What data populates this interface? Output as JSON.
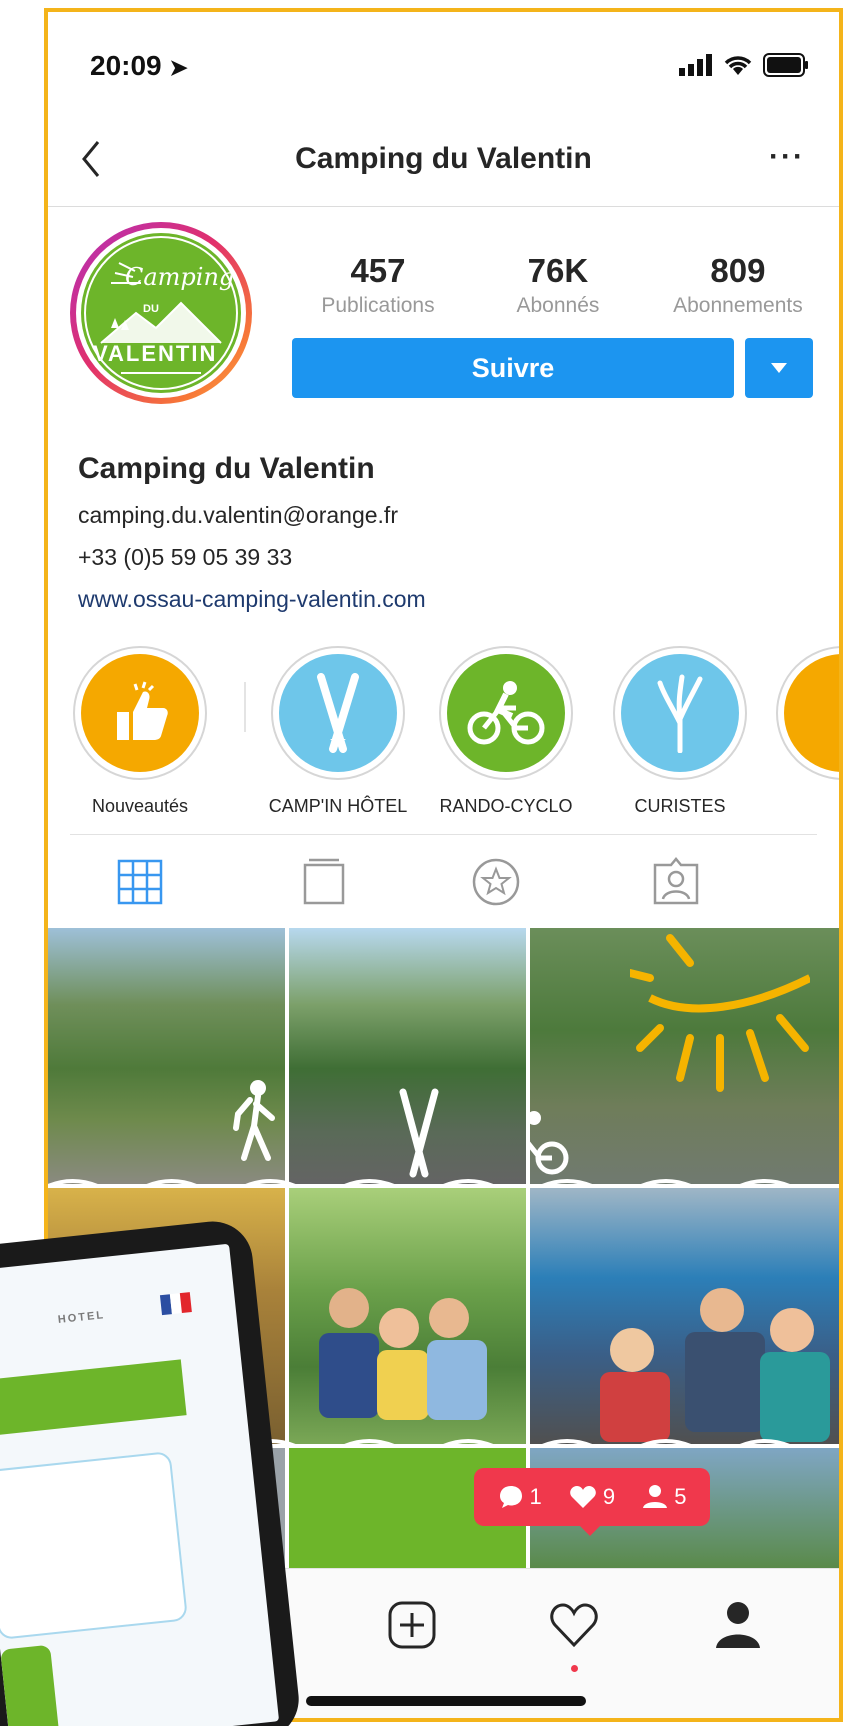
{
  "status_bar": {
    "time": "20:09"
  },
  "header": {
    "title": "Camping du Valentin",
    "more": "···"
  },
  "profile": {
    "avatar_text_top": "Camping",
    "avatar_text_du": "DU",
    "avatar_text_bottom": "VALENTIN",
    "stats": [
      {
        "value": "457",
        "label": "Publications"
      },
      {
        "value": "76K",
        "label": "Abonnés"
      },
      {
        "value": "809",
        "label": "Abonnements"
      }
    ],
    "follow_label": "Suivre"
  },
  "bio": {
    "name": "Camping du Valentin",
    "email": "camping.du.valentin@orange.fr",
    "phone": "+33 (0)5 59 05 39 33",
    "website": "www.ossau-camping-valentin.com"
  },
  "highlights": [
    {
      "label": "Nouveautés",
      "color": "#f5a800"
    },
    {
      "label": "CAMP'IN HÔTEL",
      "color": "#6ec6ea"
    },
    {
      "label": "RANDO-CYCLO",
      "color": "#6db52a"
    },
    {
      "label": "CURISTES",
      "color": "#6ec6ea"
    }
  ],
  "notification": {
    "comments": "1",
    "likes": "9",
    "followers": "5"
  },
  "tablet": {
    "menu_text": "HOTEL"
  },
  "colors": {
    "accent": "#1c95f0",
    "frame": "#f4b41a",
    "notif": "#f0384c"
  }
}
